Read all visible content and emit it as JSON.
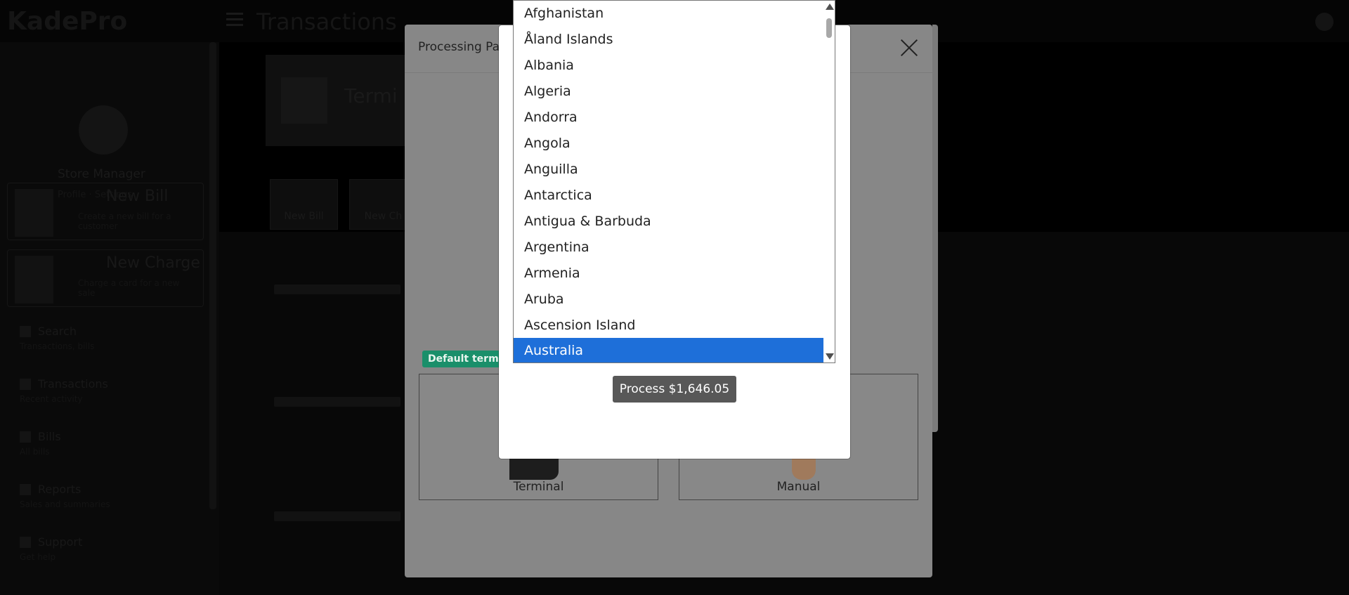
{
  "app": {
    "logo": "KadePro",
    "page_title": "Transactions"
  },
  "sidebar": {
    "role": "Store Manager",
    "sub": "Profile · Settings",
    "cards": [
      {
        "title": "New Bill",
        "desc": "Create a new bill for a customer"
      },
      {
        "title": "New Charge",
        "desc": "Charge a card for a new sale"
      }
    ],
    "items": [
      {
        "label": "Search",
        "sub": "Transactions, bills"
      },
      {
        "label": "Transactions",
        "sub": "Recent activity"
      },
      {
        "label": "Bills",
        "sub": "All bills"
      },
      {
        "label": "Reports",
        "sub": "Sales and summaries"
      },
      {
        "label": "Support",
        "sub": "Get help"
      }
    ]
  },
  "background": {
    "terminal_title": "Termi",
    "quick_buttons": [
      "New Bill",
      "New Ch"
    ]
  },
  "modal": {
    "title": "Processing Pa",
    "default_badge": "Default termina",
    "methods": [
      {
        "label": "Terminal"
      },
      {
        "label": "Manual"
      }
    ],
    "process_button": "Process $1,646.05"
  },
  "country_dropdown": {
    "options": [
      "Afghanistan",
      "Åland Islands",
      "Albania",
      "Algeria",
      "Andorra",
      "Angola",
      "Anguilla",
      "Antarctica",
      "Antigua & Barbuda",
      "Argentina",
      "Armenia",
      "Aruba",
      "Ascension Island",
      "Australia"
    ],
    "selected": "Australia"
  },
  "colors": {
    "selected_option": "#1e6fd9",
    "badge": "#1a8f6a",
    "process_button": "#585858"
  }
}
